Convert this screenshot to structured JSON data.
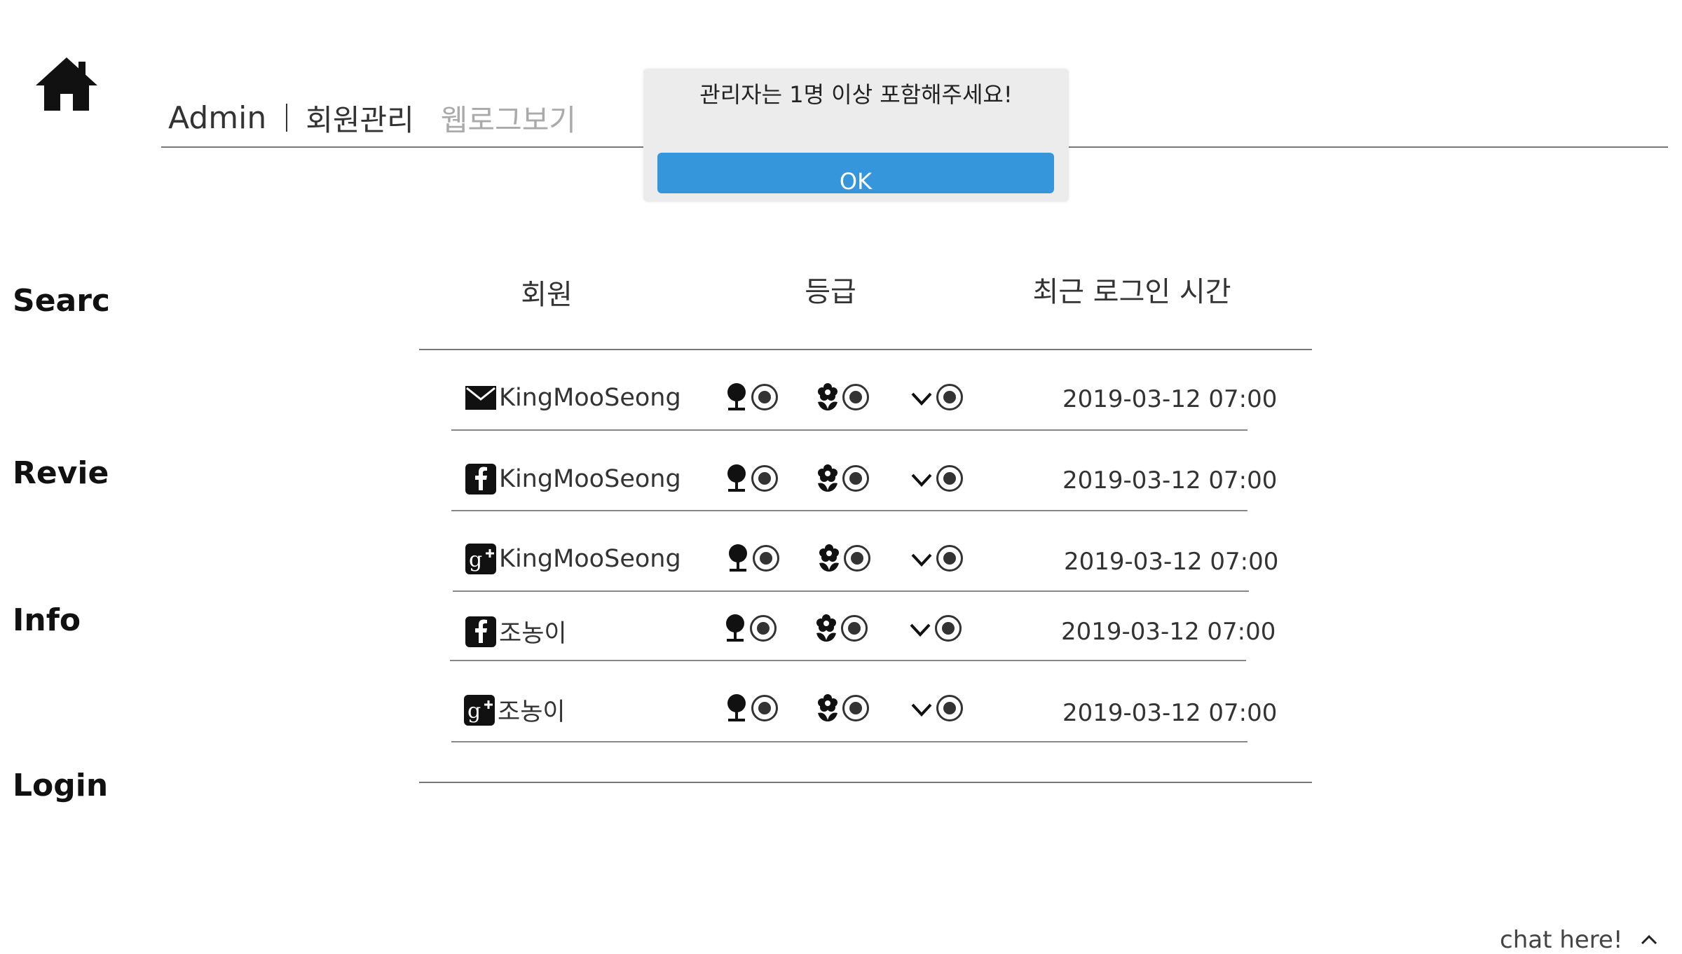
{
  "header": {
    "admin_label": "Admin",
    "nav": [
      {
        "label": "회원관리",
        "active": true
      },
      {
        "label": "웹로그보기",
        "active": false
      }
    ]
  },
  "sidebar": {
    "items": [
      {
        "label": "Searc"
      },
      {
        "label": "Revie"
      },
      {
        "label": "Info"
      },
      {
        "label": "Login"
      }
    ]
  },
  "table": {
    "columns": [
      "회원",
      "등급",
      "최근 로그인 시간"
    ],
    "rows": [
      {
        "provider_icon": "email-icon",
        "name": "KingMooSeong",
        "last_login": "2019-03-12 07:00"
      },
      {
        "provider_icon": "facebook-icon",
        "name": "KingMooSeong",
        "last_login": "2019-03-12 07:00"
      },
      {
        "provider_icon": "google-plus-icon",
        "name": "KingMooSeong",
        "last_login": "2019-03-12 07:00"
      },
      {
        "provider_icon": "facebook-icon",
        "name": "조농이",
        "last_login": "2019-03-12 07:00"
      },
      {
        "provider_icon": "google-plus-icon",
        "name": "조농이",
        "last_login": "2019-03-12 07:00"
      }
    ],
    "grade_icons": [
      "tree-icon",
      "flower-icon",
      "chevron-down-icon"
    ]
  },
  "dialog": {
    "message": "관리자는 1명 이상 포함해주세요!",
    "ok_label": "OK",
    "ok_color": "#3596dc"
  },
  "chat": {
    "label": "chat here!"
  }
}
